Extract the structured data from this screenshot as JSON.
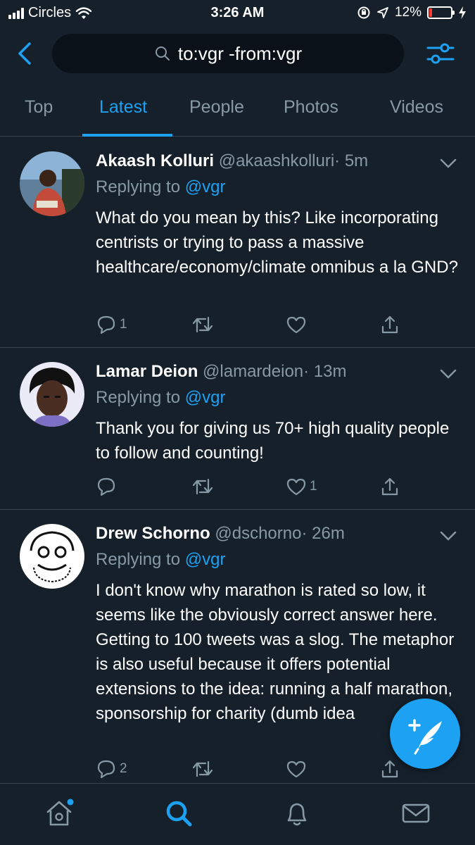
{
  "status_bar": {
    "carrier": "Circles",
    "time": "3:26 AM",
    "battery_percent": "12%",
    "battery_level": 0.12,
    "battery_color": "#ff3b30"
  },
  "search": {
    "query": "to:vgr -from:vgr",
    "back_icon": "chevron-left-icon",
    "filter_icon": "sliders-icon"
  },
  "tabs": [
    {
      "label": "Top",
      "active": false
    },
    {
      "label": "Latest",
      "active": true
    },
    {
      "label": "People",
      "active": false
    },
    {
      "label": "Photos",
      "active": false
    },
    {
      "label": "Videos",
      "active": false
    }
  ],
  "tweets": [
    {
      "name": "Akaash Kolluri",
      "handle": "@akaashkolluri",
      "separator": "·",
      "time": "5m",
      "replying_prefix": "Replying to ",
      "replying_to": "@vgr",
      "text": "What do you mean by this? Like incorporating centrists or trying to pass a massive healthcare/economy/climate omnibus a la GND?",
      "reply_count": "1",
      "retweet_count": "",
      "like_count": ""
    },
    {
      "name": "Lamar Deion",
      "handle": "@lamardeion",
      "separator": "·",
      "time": "13m",
      "replying_prefix": "Replying to ",
      "replying_to": "@vgr",
      "text": "Thank you for giving us 70+ high quality people to follow and counting!",
      "reply_count": "",
      "retweet_count": "",
      "like_count": "1"
    },
    {
      "name": "Drew Schorno",
      "handle": "@dschorno",
      "separator": "·",
      "time": "26m",
      "replying_prefix": "Replying to ",
      "replying_to": "@vgr",
      "text": "I don't know why marathon is rated so low, it seems like the obviously correct answer here. Getting to 100 tweets was a slog. The metaphor is also useful because it offers potential extensions to the idea: running a half marathon, sponsorship for charity (dumb idea",
      "reply_count": "2",
      "retweet_count": "",
      "like_count": ""
    }
  ],
  "bottom_nav": [
    {
      "icon": "home-icon",
      "active": false,
      "has_notification_dot": true
    },
    {
      "icon": "search-icon",
      "active": true
    },
    {
      "icon": "bell-icon",
      "active": false
    },
    {
      "icon": "mail-icon",
      "active": false
    }
  ],
  "fab": {
    "icon": "compose-tweet-icon"
  },
  "colors": {
    "background": "#15202b",
    "accent": "#1da1f2",
    "secondary_text": "#8899a6",
    "divider": "#38444d"
  }
}
